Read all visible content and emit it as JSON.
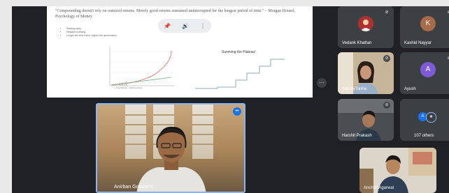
{
  "slide": {
    "quote": "\"Compounding doesn't rely on outsized returns. Merely good returns sustained uninterrupted for the longest period of time.\" – Morgan Housel, Psychology of Money",
    "bullets": [
      "Starting early.",
      "Regular Investing.",
      "Longer the time frame, higher the acceleration."
    ],
    "chart_title": "Total Savings",
    "legend": "— Total Savings   — Total Investment",
    "plateau_title": "Surviving the Plateau!"
  },
  "toolbar": {
    "pin_icon": "pin-icon",
    "volume_icon": "volume-icon",
    "more_icon": "more-vert-icon"
  },
  "speaker": {
    "name": "Anirban Goswami"
  },
  "participants": [
    {
      "name": "Vedank Khattan",
      "type": "avatar-photo"
    },
    {
      "name": "Kashid Nayyar",
      "type": "avatar",
      "initial": "K",
      "color": "#a86b4a"
    },
    {
      "name": "Sakshi Sinha",
      "type": "camera"
    },
    {
      "name": "Ayush",
      "type": "avatar",
      "initial": "A",
      "color": "#7d5bd6"
    },
    {
      "name": "Harshit Prakash",
      "type": "camera"
    },
    {
      "name": "107 others",
      "type": "others"
    },
    {
      "name": "Anchhit Agarwal",
      "type": "camera"
    }
  ],
  "colors": {
    "accent": "#8ab4f8",
    "background": "#202124",
    "tile": "#3c4043"
  }
}
